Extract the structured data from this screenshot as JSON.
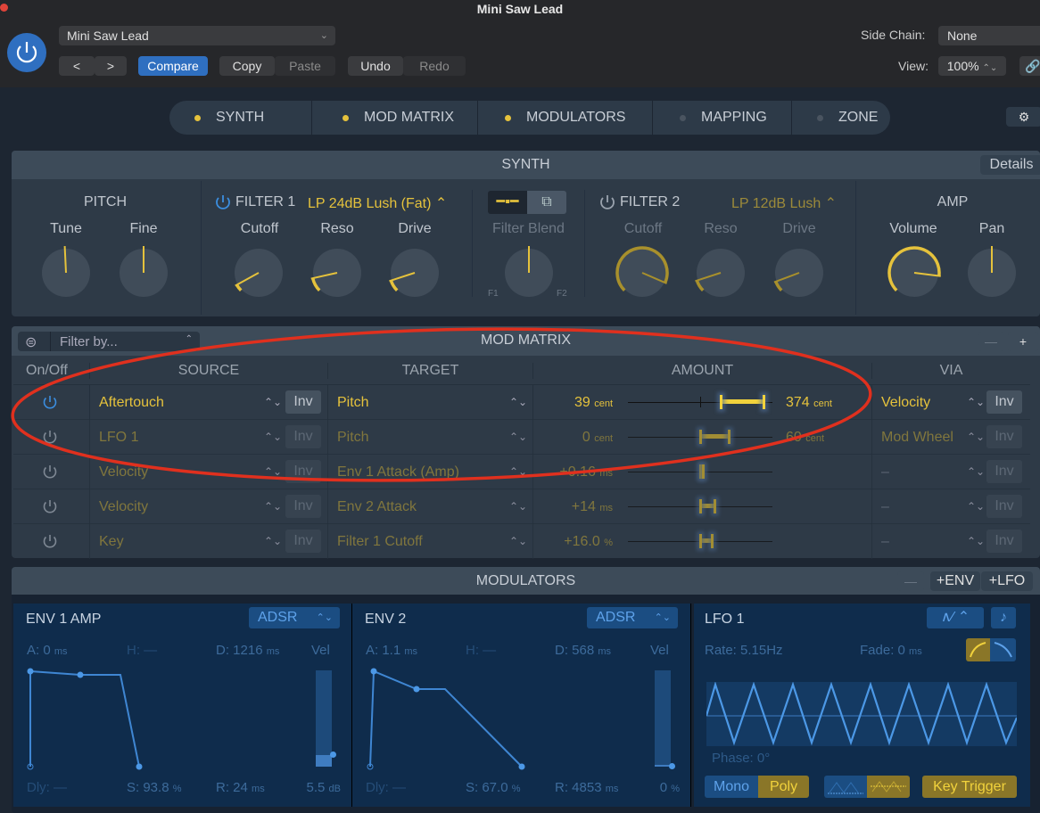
{
  "window": {
    "title": "Mini Saw Lead"
  },
  "header": {
    "preset": "Mini Saw Lead",
    "prev": "<",
    "next": ">",
    "compare": "Compare",
    "copy": "Copy",
    "paste": "Paste",
    "undo": "Undo",
    "redo": "Redo",
    "side_chain_label": "Side Chain:",
    "side_chain_value": "None",
    "view_label": "View:",
    "view_value": "100%"
  },
  "tabs": [
    {
      "label": "SYNTH",
      "led": "#e5c23c"
    },
    {
      "label": "MOD MATRIX",
      "led": "#e5c23c"
    },
    {
      "label": "MODULATORS",
      "led": "#e5c23c"
    },
    {
      "label": "MAPPING",
      "led": "#4a5460"
    },
    {
      "label": "ZONE",
      "led": "#4a5460"
    }
  ],
  "synth": {
    "title": "SYNTH",
    "details": "Details",
    "pitch": {
      "title": "PITCH",
      "knobs": [
        {
          "label": "Tune",
          "value": 0.49
        },
        {
          "label": "Fine",
          "value": 0.5
        }
      ]
    },
    "filter1": {
      "title": "FILTER 1",
      "type": "LP 24dB Lush (Fat)",
      "knobs": [
        {
          "label": "Cutoff",
          "value": 0.06
        },
        {
          "label": "Reso",
          "value": 0.12
        },
        {
          "label": "Drive",
          "value": 0.1
        }
      ]
    },
    "blend": {
      "label": "Filter Blend",
      "f1": "F1",
      "f2": "F2",
      "value": 0.5
    },
    "filter2": {
      "title": "FILTER 2",
      "type": "LP 12dB Lush",
      "knobs": [
        {
          "label": "Cutoff",
          "value": 0.92
        },
        {
          "label": "Reso",
          "value": 0.1
        },
        {
          "label": "Drive",
          "value": 0.09
        }
      ]
    },
    "amp": {
      "title": "AMP",
      "knobs": [
        {
          "label": "Volume",
          "value": 0.86
        },
        {
          "label": "Pan",
          "value": 0.5
        }
      ]
    }
  },
  "mod_matrix": {
    "title": "MOD MATRIX",
    "filter_placeholder": "Filter by...",
    "minus": "—",
    "plus": "+",
    "columns": [
      "On/Off",
      "SOURCE",
      "TARGET",
      "AMOUNT",
      "VIA"
    ],
    "rows": [
      {
        "source": "Aftertouch",
        "inv": "Inv",
        "target": "Pitch",
        "min": "39",
        "min_unit": "cent",
        "max": "374",
        "max_unit": "cent",
        "range": [
          0.64,
          0.94
        ],
        "via": "Velocity",
        "via_inv": "Inv",
        "active": true
      },
      {
        "source": "LFO 1",
        "inv": "Inv",
        "target": "Pitch",
        "min": "0",
        "min_unit": "cent",
        "max": "60",
        "max_unit": "cent",
        "range": [
          0.5,
          0.7
        ],
        "via": "Mod Wheel",
        "via_inv": "Inv",
        "active": false
      },
      {
        "source": "Velocity",
        "inv": "Inv",
        "target": "Env 1 Attack (Amp)",
        "min": "+0.16",
        "min_unit": "ms",
        "max": "",
        "max_unit": "",
        "range": [
          0.5,
          0.52
        ],
        "via": "–",
        "via_inv": "Inv",
        "active": false
      },
      {
        "source": "Velocity",
        "inv": "Inv",
        "target": "Env 2 Attack",
        "min": "+14",
        "min_unit": "ms",
        "max": "",
        "max_unit": "",
        "range": [
          0.5,
          0.6
        ],
        "via": "–",
        "via_inv": "Inv",
        "active": false
      },
      {
        "source": "Key",
        "inv": "Inv",
        "target": "Filter 1 Cutoff",
        "min": "+16.0",
        "min_unit": "%",
        "max": "",
        "max_unit": "",
        "range": [
          0.5,
          0.58
        ],
        "via": "–",
        "via_inv": "Inv",
        "active": false
      }
    ]
  },
  "modulators": {
    "title": "MODULATORS",
    "minus": "—",
    "add_env": "+ENV",
    "add_lfo": "+LFO",
    "env1": {
      "title": "ENV 1 AMP",
      "mode": "ADSR",
      "a": "A: 0",
      "a_unit": "ms",
      "h": "H: —",
      "d": "D: 1216",
      "d_unit": "ms",
      "vel": "Vel",
      "dly": "Dly: —",
      "s": "S: 93.8",
      "s_unit": "%",
      "r": "R: 24",
      "r_unit": "ms",
      "vel_val": "5.5",
      "vel_unit": "dB"
    },
    "env2": {
      "title": "ENV 2",
      "mode": "ADSR",
      "a": "A: 1.1",
      "a_unit": "ms",
      "h": "H: —",
      "d": "D: 568",
      "d_unit": "ms",
      "vel": "Vel",
      "dly": "Dly: —",
      "s": "S: 67.0",
      "s_unit": "%",
      "r": "R: 4853",
      "r_unit": "ms",
      "vel_val": "0",
      "vel_unit": "%"
    },
    "lfo1": {
      "title": "LFO 1",
      "rate": "Rate: 5.15Hz",
      "fade": "Fade: 0",
      "fade_unit": "ms",
      "phase": "Phase: 0°",
      "mono": "Mono",
      "poly": "Poly",
      "key_trigger": "Key Trigger"
    }
  },
  "annotation_color": "#e0301e"
}
